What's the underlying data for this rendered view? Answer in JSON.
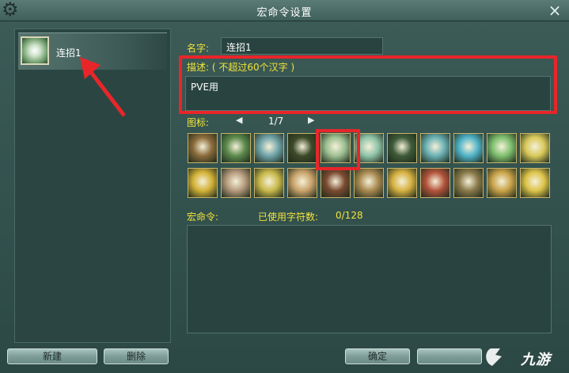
{
  "window": {
    "title": "宏命令设置"
  },
  "icons": {
    "gear": "gear-icon",
    "close": "×"
  },
  "macro_list": [
    {
      "label": "连招1"
    }
  ],
  "form": {
    "name_label": "名字:",
    "name_value": "连招1",
    "desc_label": "描述: ( 不超过60个汉字 )",
    "desc_value": "PVE用",
    "icon_label": "图标:",
    "page_prev": "◀",
    "page_text": "1/7",
    "page_next": "▶",
    "macro_label": "宏命令:",
    "chars_label": "已使用字符数:",
    "chars_count": "0/128"
  },
  "icon_grid": [
    {
      "name": "monk-icon",
      "bg": "#8a6a3a"
    },
    {
      "name": "herb-icon",
      "bg": "#5c8a4c"
    },
    {
      "name": "wave-icon",
      "bg": "#6fa3a8"
    },
    {
      "name": "runner-icon",
      "bg": "#3c4a28"
    },
    {
      "name": "flower-icon",
      "bg": "#9dbf91"
    },
    {
      "name": "moon-icon",
      "bg": "#8ec3a8"
    },
    {
      "name": "mask-icon",
      "bg": "#3d5a38"
    },
    {
      "name": "ring-icon",
      "bg": "#6ab0b3"
    },
    {
      "name": "burst-icon",
      "bg": "#4fb3c8"
    },
    {
      "name": "sparkle-icon",
      "bg": "#7ebf6e"
    },
    {
      "name": "light-icon",
      "bg": "#d8c85a"
    },
    {
      "name": "gold-flash-icon",
      "bg": "#d3b136"
    },
    {
      "name": "shatter-icon",
      "bg": "#b59a7c"
    },
    {
      "name": "blade-icon",
      "bg": "#c8b84a"
    },
    {
      "name": "face-icon",
      "bg": "#c9a36a"
    },
    {
      "name": "warrior-icon",
      "bg": "#7a4a30"
    },
    {
      "name": "web-icon",
      "bg": "#a98a50"
    },
    {
      "name": "palm-icon",
      "bg": "#d6b040"
    },
    {
      "name": "flame-icon",
      "bg": "#b3523a"
    },
    {
      "name": "statue-icon",
      "bg": "#8a7a4a"
    },
    {
      "name": "buddha-icon",
      "bg": "#c9a248"
    },
    {
      "name": "radiance-icon",
      "bg": "#dcc348"
    }
  ],
  "buttons": {
    "new": "新建",
    "delete": "删除",
    "ok": "确定",
    "cancel": ""
  },
  "watermark": "九游",
  "colors": {
    "highlight": "#e8262a",
    "label_yellow": "#f2e33a"
  }
}
